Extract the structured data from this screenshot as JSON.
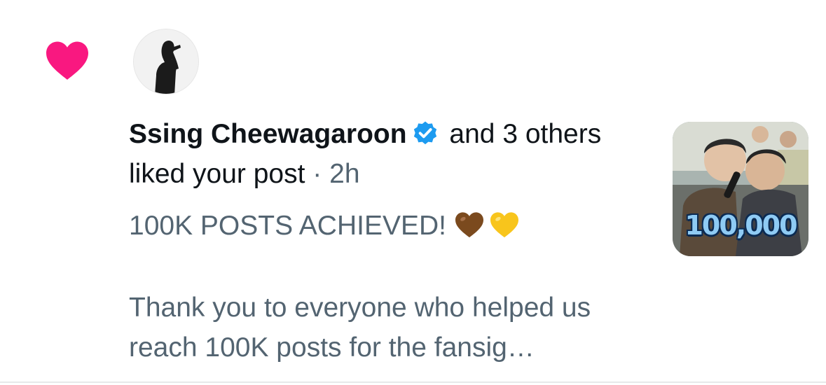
{
  "notification": {
    "icon": "heart-icon",
    "icon_color": "#f91880",
    "avatar": "avatar",
    "user_name": "Ssing Cheewagaroon",
    "verified_icon": "verified-badge-icon",
    "verified_color": "#1d9bf0",
    "headline_rest": " and 3 others liked your post",
    "separator": " · ",
    "time": "2h",
    "post_title": "100K POSTS ACHIEVED! ",
    "post_emojis": [
      "brown-heart-icon",
      "yellow-heart-icon"
    ],
    "post_body": "Thank you to everyone who helped us reach 100K posts for the fansig…",
    "thumbnail_text": "100,000"
  },
  "colors": {
    "primary_text": "#0f1419",
    "secondary_text": "#536471",
    "divider": "#e7e9ea"
  }
}
